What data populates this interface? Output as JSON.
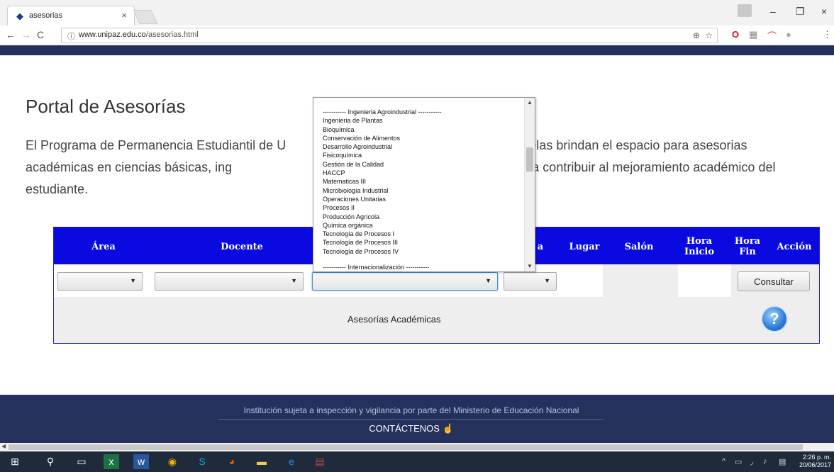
{
  "browser": {
    "tab_title": "asesorias",
    "url_host": "www.unipaz.edu.co",
    "url_path": "/asesorias.html"
  },
  "page": {
    "title": "Portal de Asesorías",
    "description": "El Programa de Permanencia Estudiantil de U                                                erentes escuelas brindan el espacio para asesorias académicas en ciencias básicas, ing                                                ma. Una estrategia para contribuir al mejoramiento académico del estudiante."
  },
  "table": {
    "headers": {
      "area": "Área",
      "docente": "Docente",
      "dia_partial": "a",
      "lugar": "Lugar",
      "salon": "Salón",
      "hora_inicio": "Hora Inicio",
      "hora_fin": "Hora Fin",
      "accion": "Acción"
    },
    "consultar_label": "Consultar",
    "footer_label": "Asesorías Académicas",
    "help_glyph": "?"
  },
  "dropdown": {
    "items": [
      "----------- Ingenieria Agroindustrial -----------",
      "Ingenieria de Plantas",
      "Bioquímica",
      "Conservación de Alimentos",
      "Desarrollo Agroindustrial",
      "Fisicoquímica",
      "Gestión de la Calidad",
      "HACCP",
      "Matematicas III",
      "Microbiología Industrial",
      "Operaciones Unitarias",
      "Procesos II",
      "Producción Agrícola",
      "Química orgánica",
      "Tecnología de Procesos I",
      "Tecnología de Procesos III",
      "Tecnología de Procesos IV",
      "",
      "----------- Internacionalización -----------"
    ]
  },
  "footer": {
    "notice": "Institución sujeta a inspección y vigilancia por parte del Ministerio de Educación Nacional",
    "contact": "CONTÁCTENOS"
  },
  "taskbar": {
    "time": "2:26 p. m.",
    "date": "20/06/2017"
  },
  "colors": {
    "header_blue": "#0a0ae0",
    "navy": "#24315c"
  }
}
